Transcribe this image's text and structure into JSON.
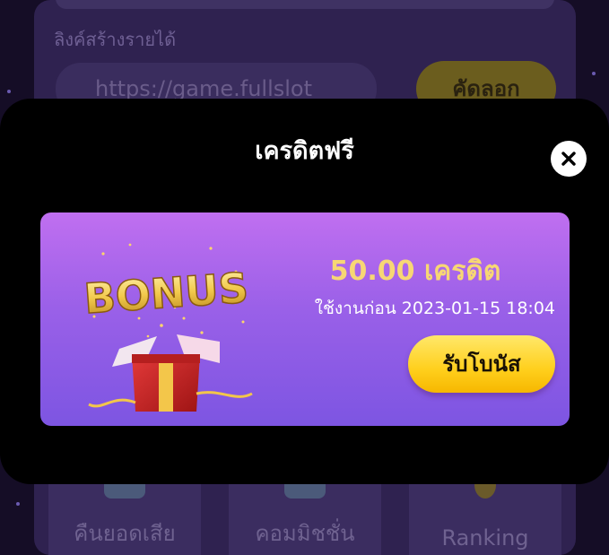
{
  "background": {
    "link_label": "ลิงค์สร้างรายได้",
    "link_value": "https://game.fullslot",
    "copy_button": "คัดลอก",
    "tiles": [
      {
        "label": "คืนยอดเสีย"
      },
      {
        "label": "คอมมิชชั่น"
      },
      {
        "label": "Ranking"
      }
    ]
  },
  "modal": {
    "title": "เครดิตฟรี",
    "close_icon": "close-icon",
    "bonus_card": {
      "image_word": "BONUS",
      "amount": "50.00 เครดิต",
      "expiry": "ใช้งานก่อน 2023-01-15 18:04",
      "claim_button": "รับโบนัส"
    }
  },
  "colors": {
    "modal_bg": "#000000",
    "card_gradient_top": "#c06ff0",
    "card_gradient_bottom": "#7d55e2",
    "amount_text": "#f7d774",
    "button_yellow": "#ffcf1c"
  }
}
